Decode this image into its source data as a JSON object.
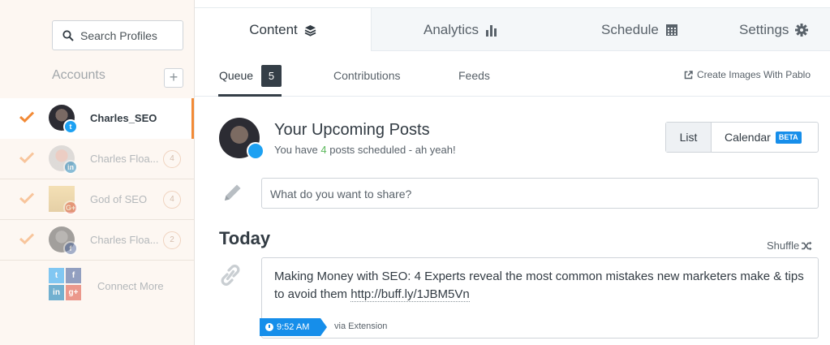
{
  "sidebar": {
    "search_placeholder": "Search Profiles",
    "accounts_heading": "Accounts",
    "add_label": "+",
    "accounts": [
      {
        "name": "Charles_SEO",
        "network": "twitter",
        "count": ""
      },
      {
        "name": "Charles Floa...",
        "network": "linkedin",
        "count": "4"
      },
      {
        "name": "God of SEO",
        "network": "google-plus",
        "count": "4"
      },
      {
        "name": "Charles Floa...",
        "network": "facebook",
        "count": "2"
      }
    ],
    "connect_more": "Connect More"
  },
  "tabs": [
    {
      "label": "Content",
      "icon": "layers-icon"
    },
    {
      "label": "Analytics",
      "icon": "bar-chart-icon"
    },
    {
      "label": "Schedule",
      "icon": "calendar-icon"
    },
    {
      "label": "Settings",
      "icon": "gear-icon"
    }
  ],
  "subtabs": {
    "queue": "Queue",
    "queue_count": "5",
    "contributions": "Contributions",
    "feeds": "Feeds",
    "pablo": "Create Images With Pablo"
  },
  "upcoming": {
    "title": "Your Upcoming Posts",
    "sub_prefix": "You have",
    "sub_count": "4",
    "sub_suffix": "posts scheduled - ah yeah!"
  },
  "view_toggle": {
    "list": "List",
    "calendar": "Calendar",
    "beta": "BETA"
  },
  "composer": {
    "placeholder": "What do you want to share?"
  },
  "today": {
    "heading": "Today",
    "shuffle": "Shuffle"
  },
  "post": {
    "text": "Making Money with SEO: 4 Experts reveal the most common mistakes new marketers make & tips to avoid them",
    "url": "http://buff.ly/1JBM5Vn",
    "time": "9:52 AM",
    "via": "via Extension"
  },
  "colors": {
    "accent_orange": "#f28a36",
    "buffer_blue": "#168eea",
    "twitter": "#1da1f2",
    "linkedin": "#0077b5",
    "google_plus": "#dd4b39",
    "facebook": "#3b5998",
    "green": "#5cb85c"
  }
}
